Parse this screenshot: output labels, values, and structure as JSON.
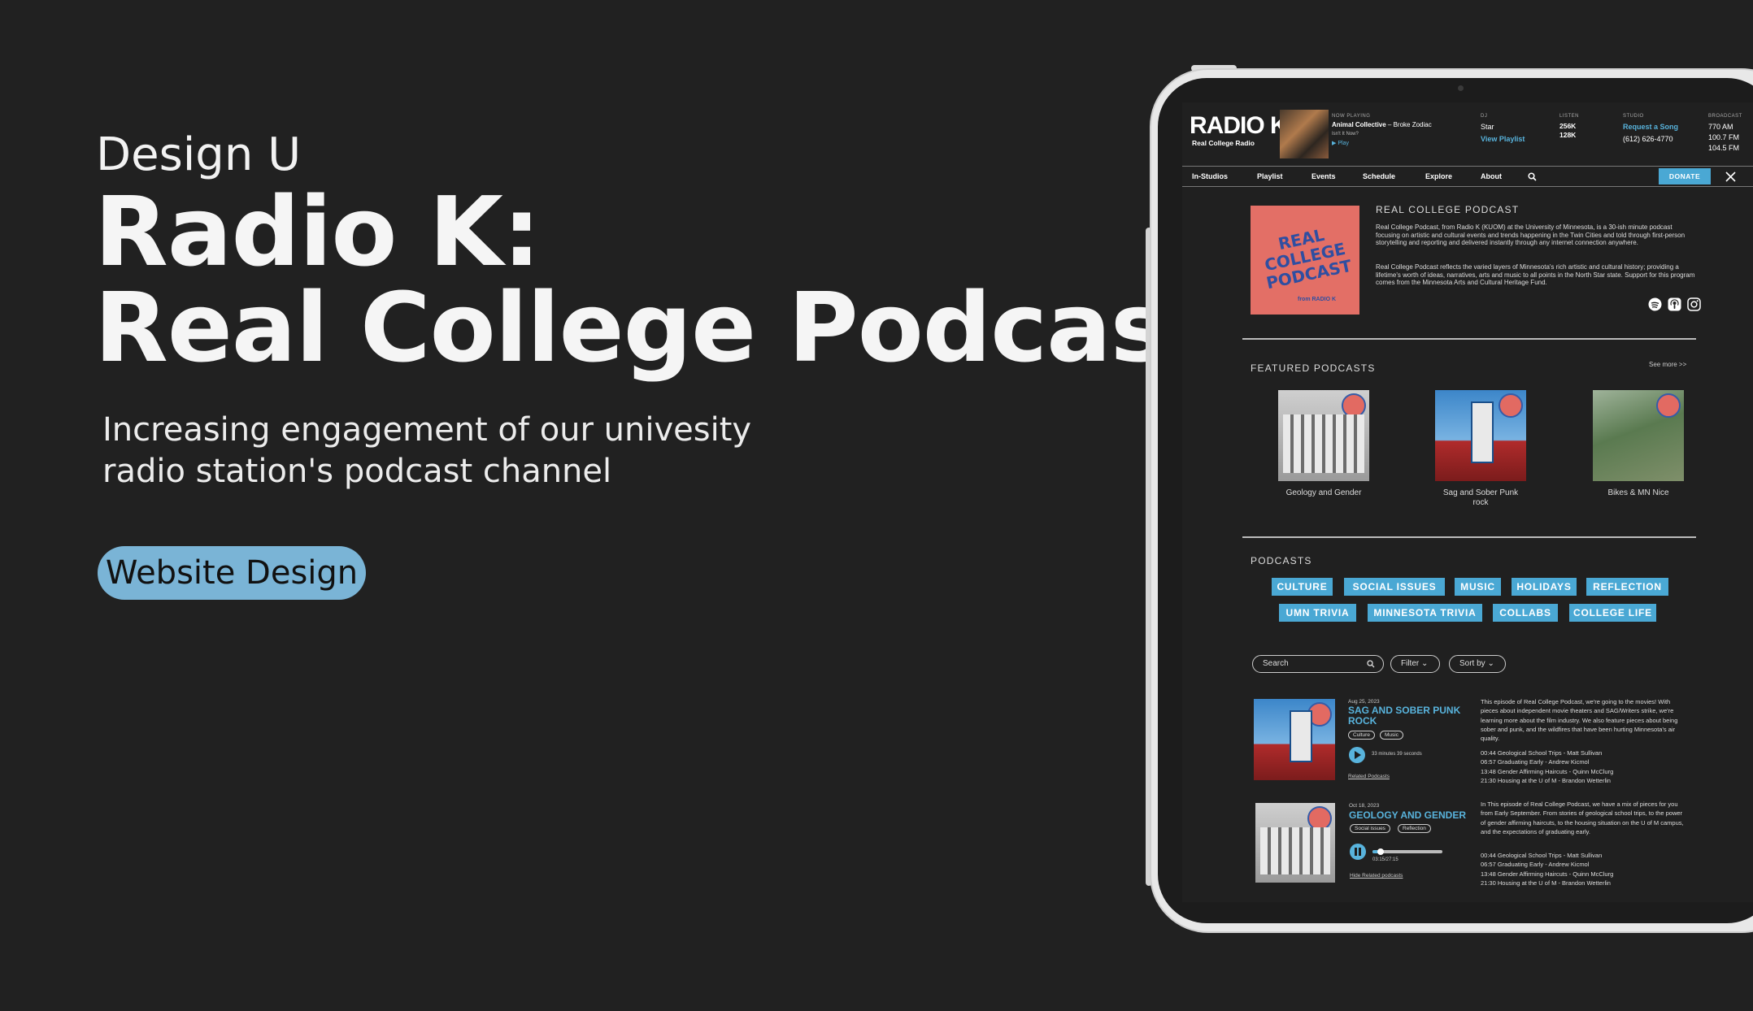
{
  "hero": {
    "kicker": "Design U",
    "title_line1": "Radio K:",
    "title_line2": "Real College Podcast",
    "subtitle_line1": "Increasing engagement of our univesity",
    "subtitle_line2": "radio station's podcast channel",
    "tag": "Website Design"
  },
  "site": {
    "logo": "RADIO K",
    "logo_sub": "Real College Radio",
    "now_playing": {
      "label": "NOW PLAYING",
      "artist": "Animal Collective",
      "track": "– Broke Zodiac",
      "album": "Isn't It Now?",
      "play": "▶ Play"
    },
    "dj": {
      "label": "DJ",
      "name": "Star",
      "link": "View Playlist"
    },
    "listen": {
      "label": "LISTEN",
      "v1": "256K",
      "v2": "128K"
    },
    "studio": {
      "label": "STUDIO",
      "link": "Request a Song",
      "phone": "(612) 626-4770"
    },
    "broadcast": {
      "label": "BROADCAST",
      "f1": "770 AM",
      "f2": "100.7 FM",
      "f3": "104.5 FM"
    },
    "nav": [
      "In-Studios",
      "Playlist",
      "Events",
      "Schedule",
      "Explore",
      "About"
    ],
    "donate": "DONATE",
    "about": {
      "cover_text": "REAL COLLEGE PODCAST",
      "cover_from": "from RADIO K",
      "heading": "REAL COLLEGE PODCAST",
      "p1": "Real College Podcast, from Radio K (KUOM) at the University of Minnesota, is a 30-ish minute podcast focusing on artistic and cultural events and trends happening in the Twin Cities and told through first-person storytelling and reporting and delivered instantly through any internet connection anywhere.",
      "p2": "Real College Podcast reflects the varied layers of Minnesota's rich artistic and cultural history; providing a lifetime's worth of ideas, narratives, arts and music to all points in the North Star state. Support for this program comes from the Minnesota Arts and Cultural Heritage Fund."
    },
    "featured": {
      "heading": "FEATURED PODCASTS",
      "see_more": "See more >>",
      "items": [
        {
          "caption": "Geology and Gender"
        },
        {
          "caption": "Sag and Sober Punk rock"
        },
        {
          "caption": "Bikes & MN Nice"
        }
      ]
    },
    "podcasts": {
      "heading": "PODCASTS",
      "tags_row1": [
        "CULTURE",
        "SOCIAL ISSUES",
        "MUSIC",
        "HOLIDAYS",
        "REFLECTION"
      ],
      "tags_row2": [
        "UMN TRIVIA",
        "MINNESOTA TRIVIA",
        "COLLABS",
        "COLLEGE LIFE"
      ],
      "search_placeholder": "Search",
      "filter": "Filter",
      "sort": "Sort by"
    },
    "episodes": [
      {
        "date": "Aug 25, 2023",
        "title": "SAG AND SOBER PUNK ROCK",
        "chips": [
          "Culture",
          "Music"
        ],
        "duration": "33 minutes 39 seconds",
        "related": "Related Podcasts",
        "desc": "This episode of Real College Podcast, we're going to the movies! With pieces about independent movie theaters and SAG/Writers strike, we're learning more about the film industry. We also feature pieces about being sober and punk, and the wildfires that have been hurting Minnesota's air quality.",
        "chapters": [
          "00:44  Geological School Trips - Matt Sullivan",
          "06:57  Graduating Early - Andrew Kicmol",
          "13:48  Gender Affirming Haircuts - Quinn McClurg",
          "21:30  Housing at the U of M - Brandon Wetterlin"
        ]
      },
      {
        "date": "Oct 18, 2023",
        "title": "GEOLOGY AND GENDER",
        "chips": [
          "Social issues",
          "Reflection"
        ],
        "time": "03:15/27:15",
        "progress": 0.12,
        "related": "Hide Related podcasts",
        "desc": "In This episode of Real College Podcast, we have a mix of pieces for you from Early September. From stories of geological school trips, to the power of gender affirming haircuts, to the housing situation on the U of M campus, and the expectations of graduating early.",
        "chapters": [
          "00:44  Geological School Trips - Matt Sullivan",
          "06:57  Graduating Early - Andrew Kicmol",
          "13:48  Gender Affirming Haircuts - Quinn McClurg",
          "21:30  Housing at the U of M - Brandon Wetterlin"
        ]
      }
    ]
  }
}
